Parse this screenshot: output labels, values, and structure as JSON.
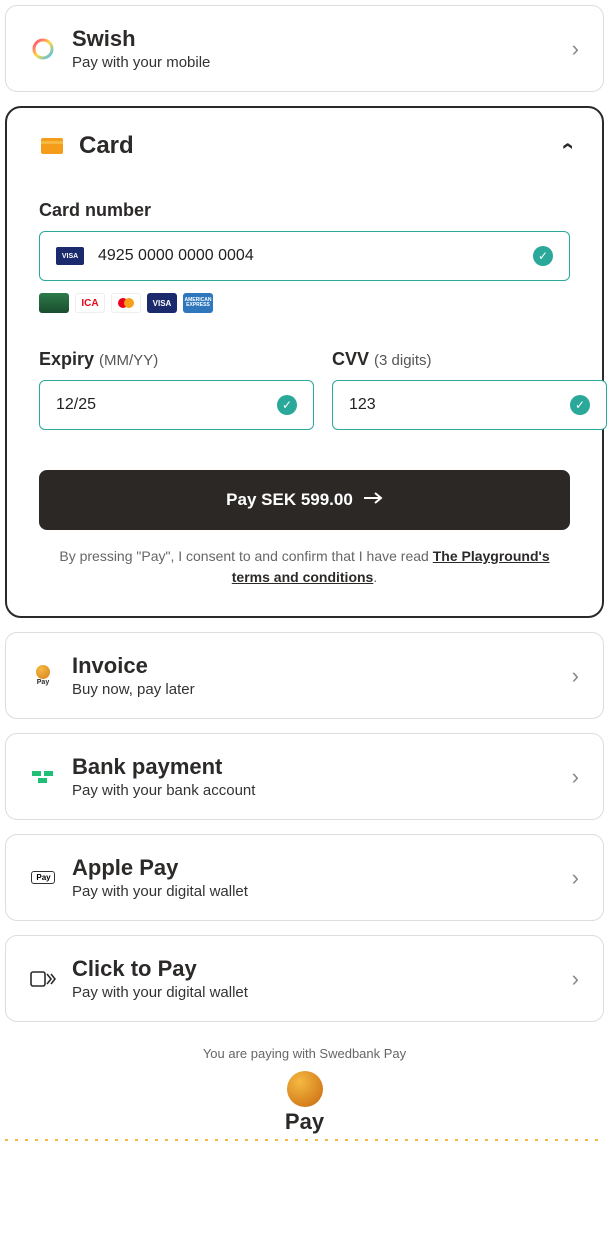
{
  "options": {
    "swish": {
      "title": "Swish",
      "subtitle": "Pay with your mobile"
    },
    "card": {
      "title": "Card"
    },
    "invoice": {
      "title": "Invoice",
      "subtitle": "Buy now, pay later"
    },
    "bank": {
      "title": "Bank payment",
      "subtitle": "Pay with your bank account"
    },
    "apple": {
      "title": "Apple Pay",
      "subtitle": "Pay with your digital wallet"
    },
    "click": {
      "title": "Click to Pay",
      "subtitle": "Pay with your digital wallet"
    }
  },
  "card_form": {
    "number_label": "Card number",
    "number_value": "4925 0000 0000 0004",
    "expiry_label": "Expiry ",
    "expiry_hint": "(MM/YY)",
    "expiry_value": "12/25",
    "cvv_label": "CVV ",
    "cvv_hint": "(3 digits)",
    "cvv_value": "123",
    "pay_button": "Pay SEK 599.00",
    "consent_prefix": "By pressing \"Pay\", I consent to and confirm that I have read ",
    "consent_link": "The Playground's terms and conditions",
    "consent_suffix": "."
  },
  "footer": {
    "text": "You are paying with Swedbank Pay",
    "brand": "Pay"
  }
}
